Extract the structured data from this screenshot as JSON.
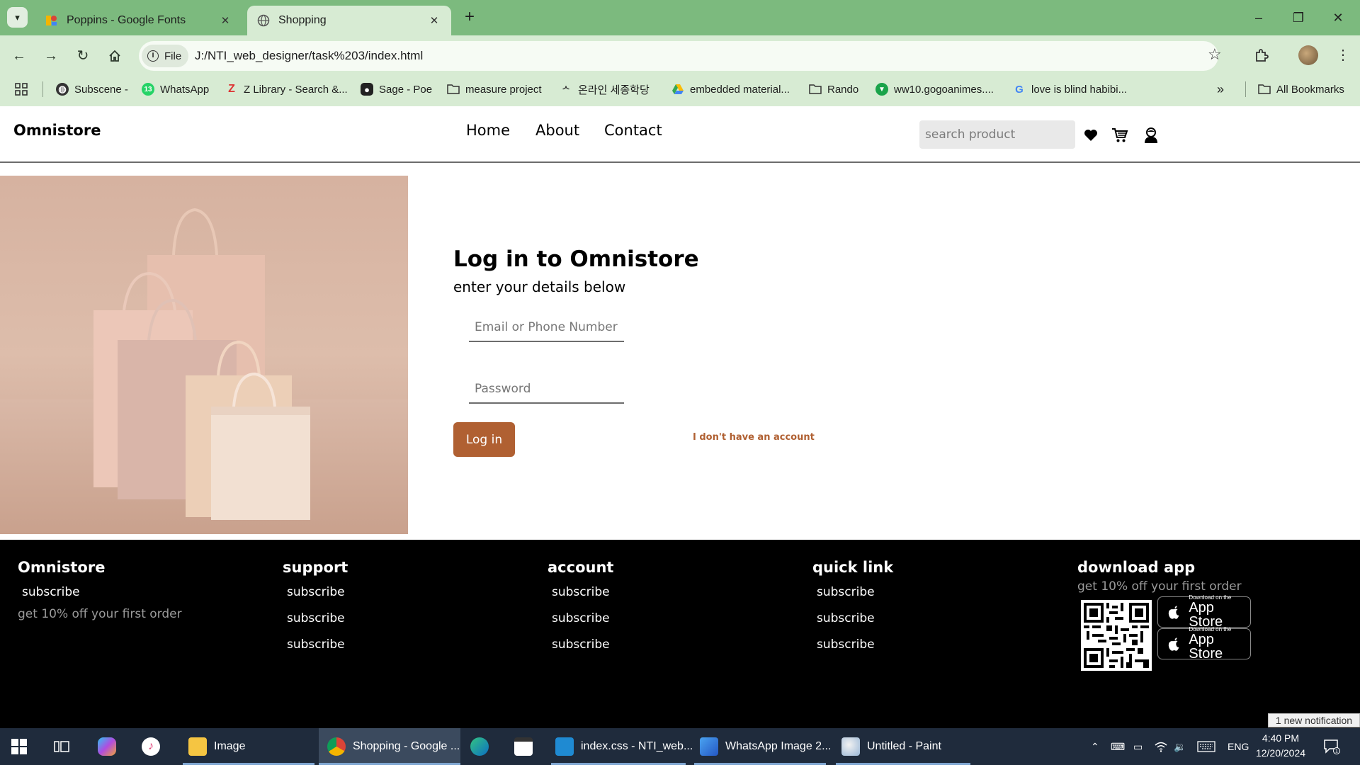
{
  "browser": {
    "tabs": [
      {
        "title": "Poppins - Google Fonts",
        "active": false
      },
      {
        "title": "Shopping",
        "active": true
      }
    ],
    "site_chip": "File",
    "url": "J:/NTI_web_designer/task%203/index.html",
    "bookmarks": [
      "Subscene -",
      "WhatsApp",
      "Z Library - Search &...",
      "Sage - Poe",
      "measure project",
      "온라인 세종학당",
      "embedded material...",
      "Rando",
      "ww10.gogoanimes....",
      "love is blind habibi...",
      "All Bookmarks"
    ]
  },
  "header": {
    "brand": "Omnistore",
    "nav": [
      "Home",
      "About",
      "Contact"
    ],
    "search_placeholder": "search product",
    "icons": [
      "heart-icon",
      "cart-icon",
      "user-icon"
    ]
  },
  "login": {
    "title": "Log in to Omnistore",
    "subtitle": "enter your details below",
    "email_placeholder": "Email or Phone Number",
    "password_placeholder": "Password",
    "button": "Log in",
    "no_account": "I don't have an account"
  },
  "footer": {
    "columns": [
      {
        "heading": "Omnistore",
        "links": [
          "subscribe"
        ],
        "text": "get 10% off your first order"
      },
      {
        "heading": "support",
        "links": [
          "subscribe",
          "subscribe",
          "subscribe"
        ]
      },
      {
        "heading": "account",
        "links": [
          "subscribe",
          "subscribe",
          "subscribe"
        ]
      },
      {
        "heading": "quick link",
        "links": [
          "subscribe",
          "subscribe",
          "subscribe"
        ]
      },
      {
        "heading": "download app",
        "text": "get 10% off your first order"
      }
    ],
    "app_store": {
      "small": "Download on the",
      "big": "App Store"
    }
  },
  "notification": "1 new notification",
  "taskbar": {
    "apps": [
      {
        "label": "Image",
        "icon": "file-explorer-icon"
      },
      {
        "label": "Shopping - Google ...",
        "icon": "chrome-icon"
      },
      {
        "label": "index.css - NTI_web...",
        "icon": "vscode-icon"
      },
      {
        "label": "WhatsApp Image 2...",
        "icon": "photos-icon"
      },
      {
        "label": "Untitled - Paint",
        "icon": "paint-icon"
      }
    ],
    "language": "ENG",
    "time": "4:40 PM",
    "date": "12/20/2024"
  },
  "colors": {
    "browser_frame": "#7cba7e",
    "toolbar": "#d7ebd3",
    "accent": "#b06032",
    "footer_bg": "#000000",
    "taskbar": "#1f2b3c"
  }
}
